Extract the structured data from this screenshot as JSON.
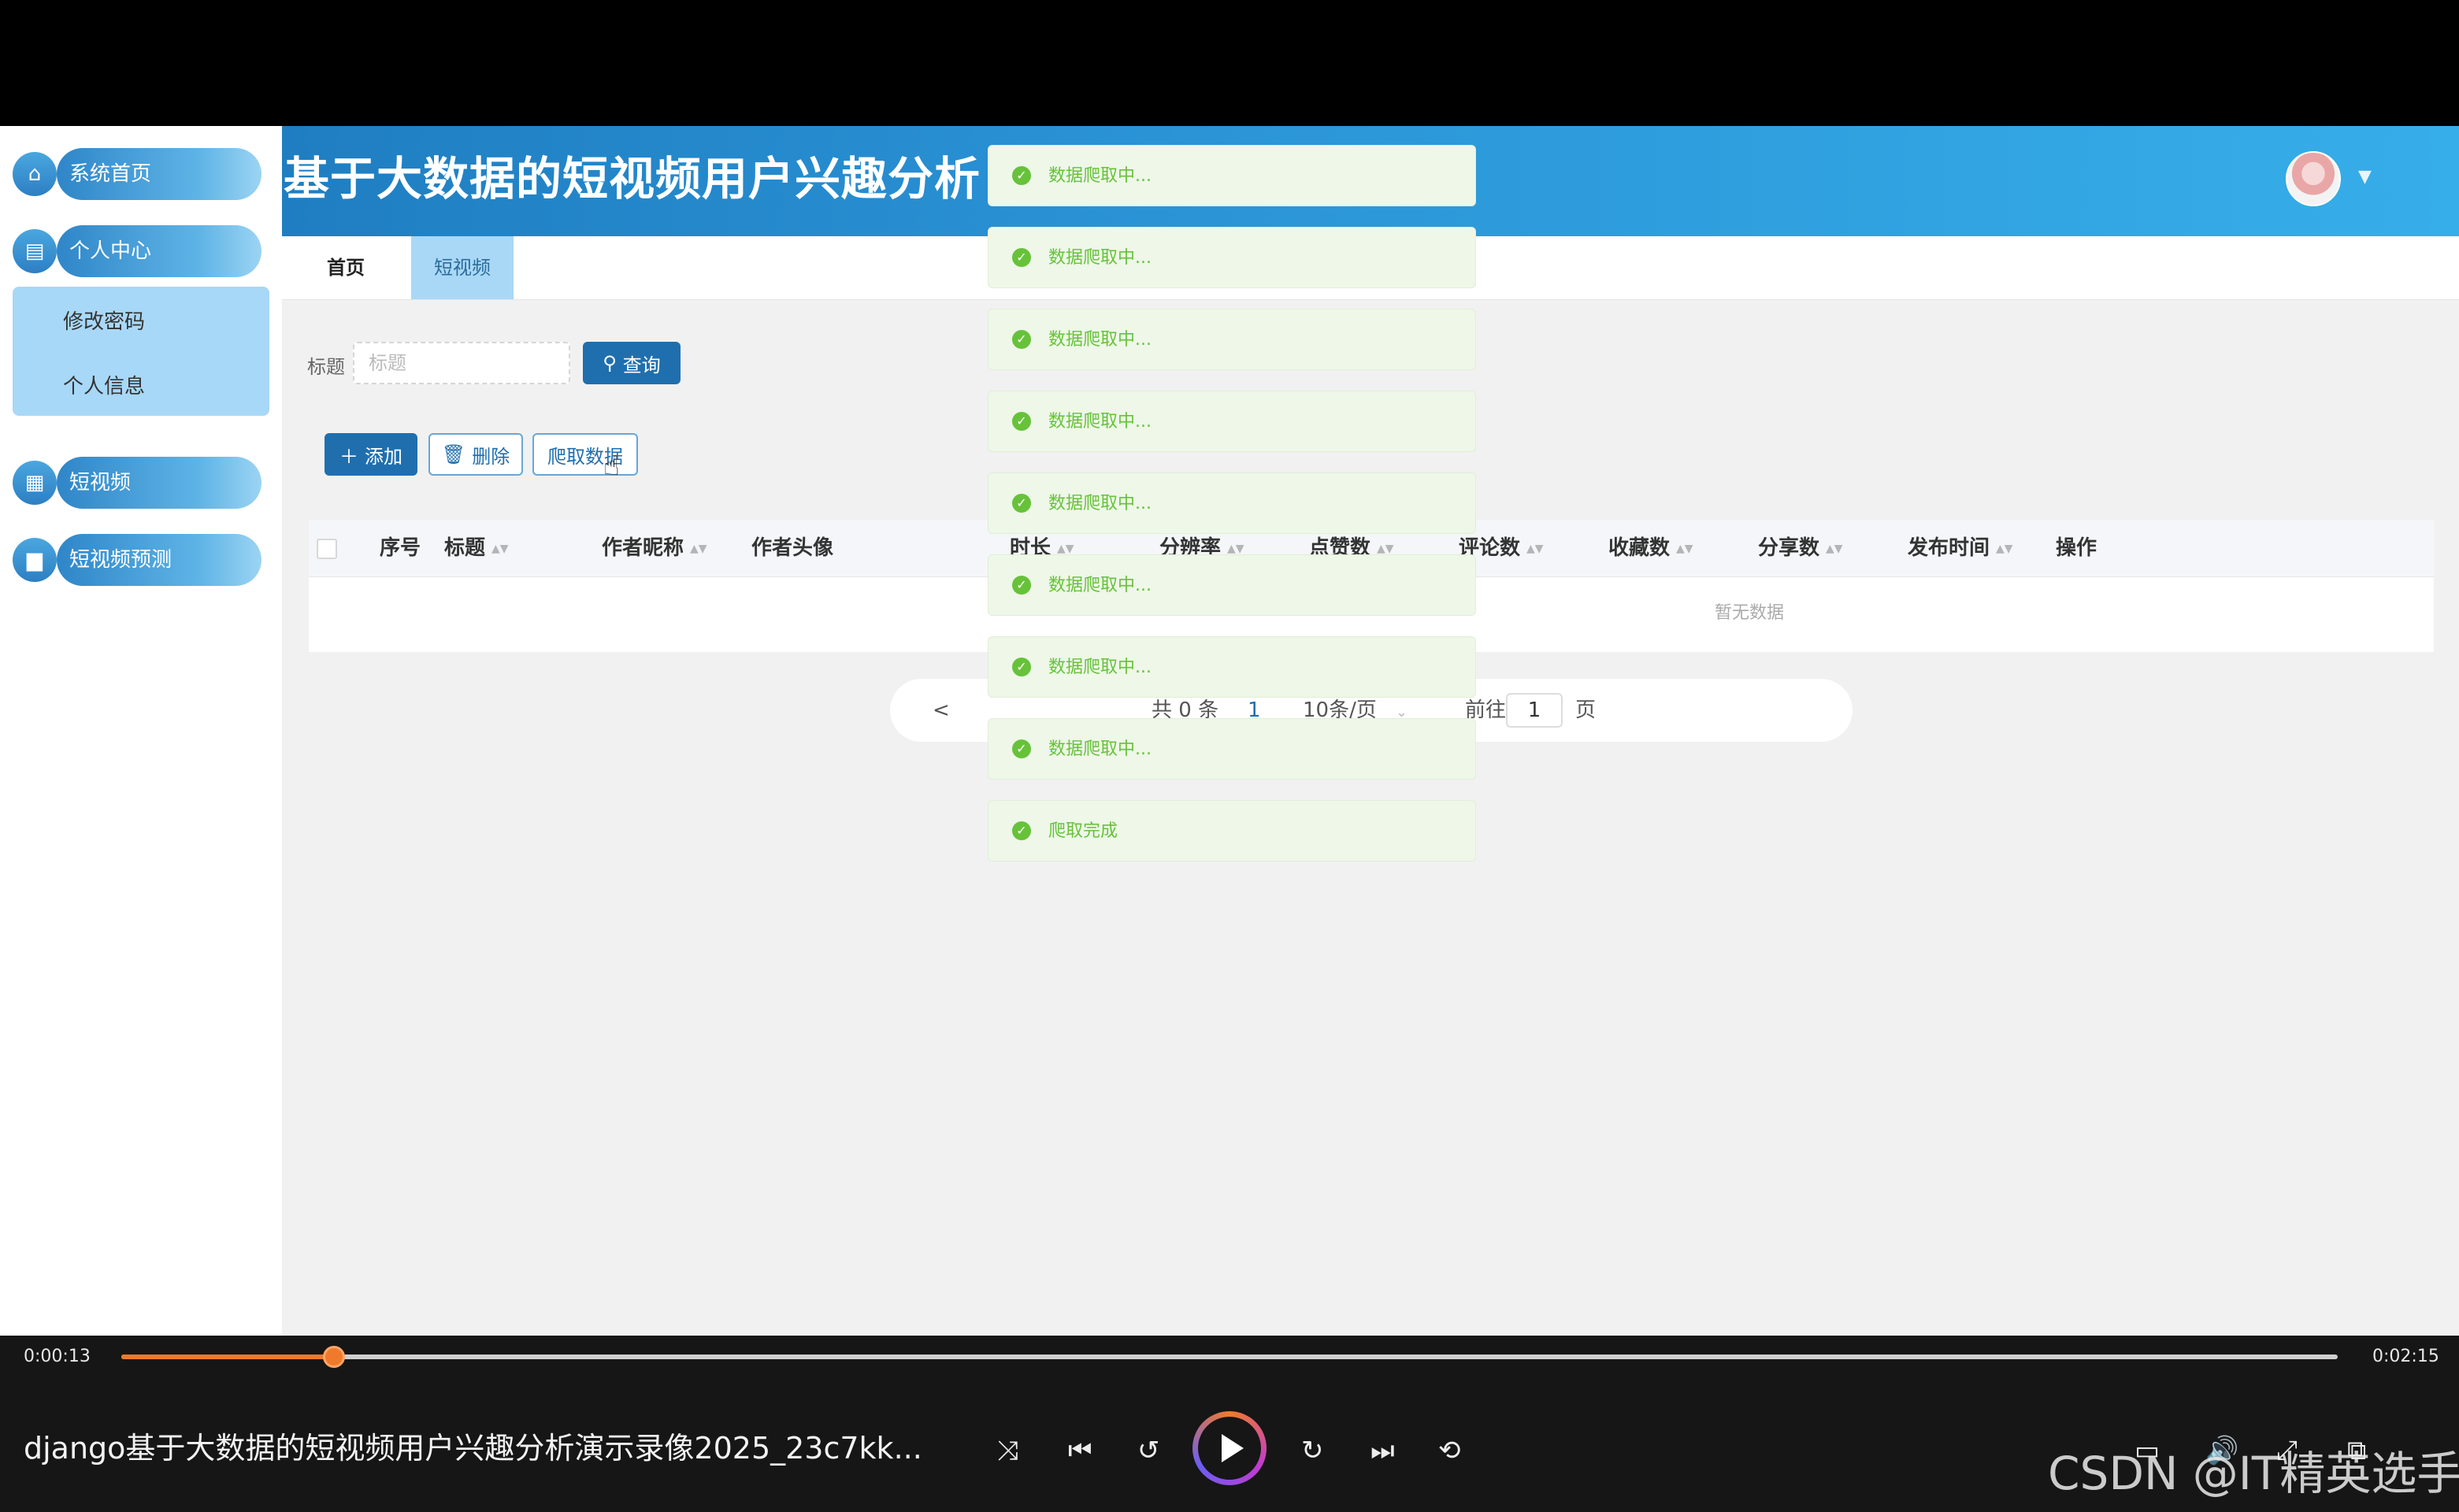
{
  "app": {
    "title": "基于大数据的短视频用户兴趣分析"
  },
  "sidebar": {
    "items": [
      {
        "label": "系统首页",
        "icon": "home-icon"
      },
      {
        "label": "个人中心",
        "icon": "calendar-icon"
      },
      {
        "label": "短视频",
        "icon": "grid-icon"
      },
      {
        "label": "短视频预测",
        "icon": "briefcase-icon"
      }
    ],
    "subitems": [
      {
        "label": "修改密码"
      },
      {
        "label": "个人信息"
      }
    ]
  },
  "tabs": [
    {
      "label": "首页"
    },
    {
      "label": "短视频"
    }
  ],
  "search": {
    "label": "标题",
    "placeholder": "标题",
    "query_label": "查询"
  },
  "toolbar": {
    "add_label": "添加",
    "delete_label": "删除",
    "crawl_label": "爬取数据"
  },
  "table": {
    "columns": [
      "序号",
      "标题",
      "作者昵称",
      "作者头像",
      "时长",
      "分辨率",
      "点赞数",
      "评论数",
      "收藏数",
      "分享数",
      "发布时间",
      "操作"
    ],
    "empty_text": "暂无数据"
  },
  "pagination": {
    "prev": "<",
    "total": "共 0 条",
    "current_page": "1",
    "page_size": "10条/页",
    "goto_label": "前往",
    "goto_value": "1",
    "page_unit": "页"
  },
  "toasts": [
    {
      "text": "数据爬取中..."
    },
    {
      "text": "数据爬取中..."
    },
    {
      "text": "数据爬取中..."
    },
    {
      "text": "数据爬取中..."
    },
    {
      "text": "数据爬取中..."
    },
    {
      "text": "数据爬取中..."
    },
    {
      "text": "数据爬取中..."
    },
    {
      "text": "数据爬取中..."
    },
    {
      "text": "爬取完成"
    }
  ],
  "player": {
    "time_current": "0:00:13",
    "time_total": "0:02:15",
    "progress_fraction": 0.096,
    "video_title": "django基于大数据的短视频用户兴趣分析演示录像2025_23c7kk...",
    "watermark": "CSDN @IT精英选手"
  },
  "colors": {
    "accent": "#1f6fae",
    "success": "#67c23a",
    "progress": "#f07a2b"
  }
}
